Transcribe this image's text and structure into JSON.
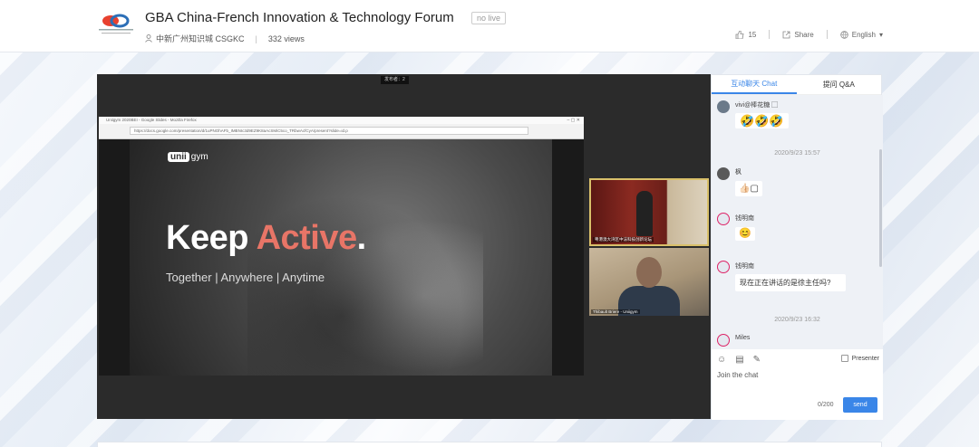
{
  "header": {
    "title": "GBA China-French Innovation & Technology Forum",
    "live_badge": "no live",
    "channel": "中新广州知识城 CSGKC",
    "views": "332 views",
    "likes": "15",
    "share": "Share",
    "language": "English"
  },
  "player": {
    "top_label": "发布者：2",
    "browser_title": "Uniigym 2020BEI - Google Slides - Mozilla Firefox",
    "browser_url": "https://docs.google.com/presentation/d/1uPNOhAFb_IMBNIc3d9EZ9K8aAcSMiC5co_TRbwAcfCyA/present?slide=id.p",
    "slide": {
      "brand_prefix": "unii",
      "brand_suffix": "gym",
      "headline_1": "Keep ",
      "headline_2": "Active",
      "headline_dot": ".",
      "tagline": "Together  |  Anywhere  |  Anytime"
    },
    "cam1_label": "粤港澳大湾区中法科技创新论坛",
    "cam2_label": "Thibault Briere - Uniigym"
  },
  "chat": {
    "tab_chat": "互动聊天 Chat",
    "tab_qa": "提问 Q&A",
    "messages": [
      {
        "user": "vivi@棒花糖 ▢",
        "text": "🤣🤣🤣"
      },
      {
        "time": "2020/9/23 15:57"
      },
      {
        "user": "枫",
        "text": "👍🏻▢"
      },
      {
        "user": "钱明南",
        "text": "😊"
      },
      {
        "user": "钱明南",
        "text": "现在正在讲话的是徐主任吗?"
      },
      {
        "time": "2020/9/23 16:32"
      },
      {
        "user": "Miles"
      }
    ],
    "presenter": "Presenter",
    "placeholder": "Join the chat",
    "counter": "0/200",
    "send": "send"
  },
  "colors": {
    "accent": "#3a86e8",
    "highlight": "#e87567"
  }
}
